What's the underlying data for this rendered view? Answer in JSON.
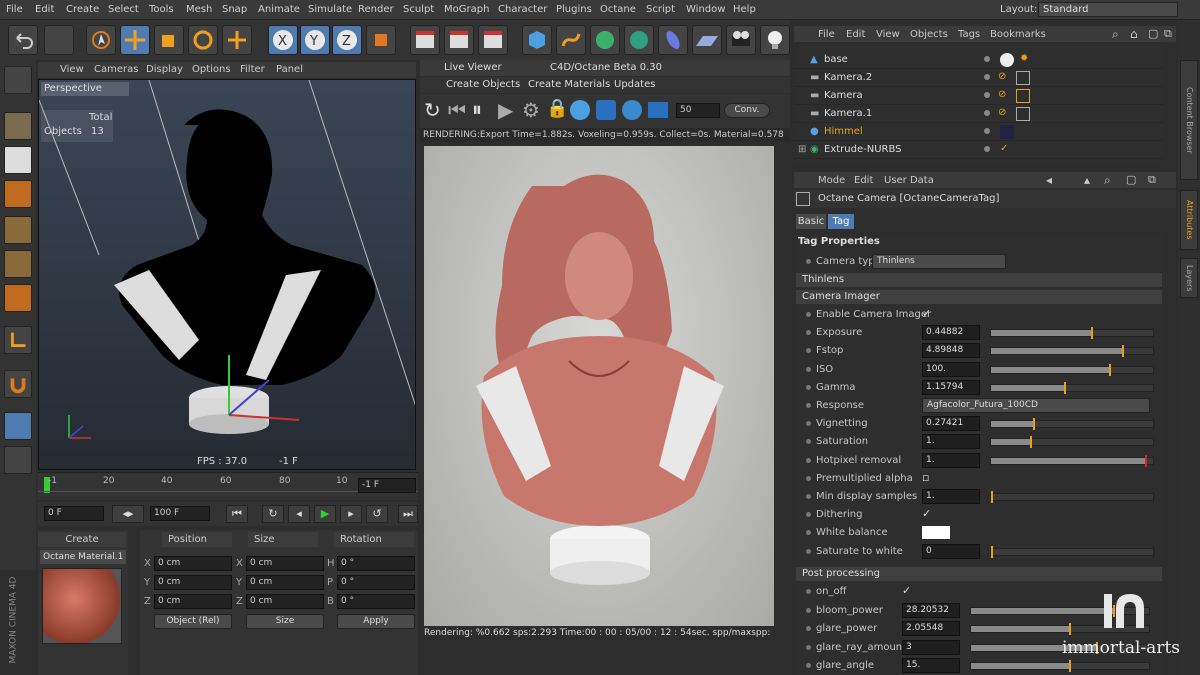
{
  "menubar": {
    "items": [
      "File",
      "Edit",
      "Create",
      "Select",
      "Tools",
      "Mesh",
      "Snap",
      "Animate",
      "Simulate",
      "Render",
      "Sculpt",
      "MoGraph",
      "Character",
      "Plugins",
      "Octane",
      "Script",
      "Window",
      "Help"
    ],
    "layout_label": "Layout:",
    "layout_value": "Standard"
  },
  "viewport": {
    "menu": [
      "View",
      "Cameras",
      "Display",
      "Options",
      "Filter",
      "Panel"
    ],
    "label": "Perspective",
    "stats_header": "Total",
    "stats_label": "Objects",
    "stats_value": "13",
    "fps": "FPS : 37.0",
    "frame": "-1 F"
  },
  "timeline": {
    "ticks": [
      "-1",
      "20",
      "40",
      "60",
      "80",
      "10"
    ],
    "end_field": "-1 F",
    "start_frame": "0 F",
    "end_frame": "100 F"
  },
  "material": {
    "create": "Create",
    "name": "Octane Material.1"
  },
  "coords": {
    "headers": [
      "Position",
      "Size",
      "Rotation"
    ],
    "rows": [
      {
        "axis": "X",
        "pos": "0 cm",
        "size": "0 cm",
        "rot_axis": "H",
        "rot": "0 °"
      },
      {
        "axis": "Y",
        "pos": "0 cm",
        "size": "0 cm",
        "rot_axis": "P",
        "rot": "0 °"
      },
      {
        "axis": "Z",
        "pos": "0 cm",
        "size": "0 cm",
        "rot_axis": "B",
        "rot": "0 °"
      }
    ],
    "mode": "Object (Rel)",
    "size_mode": "Size",
    "apply": "Apply"
  },
  "live_viewer": {
    "title": "Live Viewer",
    "subtitle": "C4D/Octane Beta 0.30",
    "tabs": [
      "Create Objects",
      "Create Materials",
      "Updates"
    ],
    "value_field": "50",
    "conv": "Conv.",
    "status": "RENDERING:Export Time=1.882s. Voxeling=0.959s. Collect=0s. Material=0.578",
    "bottom": "Rendering: %0.662 sps:2.293 Time:00 : 00 : 05/00 : 12 : 54sec. spp/maxspp:"
  },
  "object_manager": {
    "menu": [
      "File",
      "Edit",
      "View",
      "Objects",
      "Tags",
      "Bookmarks"
    ],
    "objects": [
      "base",
      "Kamera.2",
      "Kamera",
      "Kamera.1",
      "Himmel",
      "Extrude-NURBS"
    ]
  },
  "attributes": {
    "menu": [
      "Mode",
      "Edit",
      "User Data"
    ],
    "title": "Octane Camera [OctaneCameraTag]",
    "tabs": [
      "Basic",
      "Tag"
    ],
    "section_main": "Tag Properties",
    "camera_type_label": "Camera type",
    "camera_type_value": "Thinlens",
    "sections": [
      "Thinlens",
      "Camera Imager",
      "Post processing"
    ],
    "imager": [
      {
        "label": "Enable Camera Imager",
        "type": "check",
        "checked": true
      },
      {
        "label": "Exposure",
        "value": "0.44882",
        "fill": 0.62
      },
      {
        "label": "Fstop",
        "value": "4.89848",
        "fill": 0.81
      },
      {
        "label": "ISO",
        "value": "100.",
        "fill": 0.73
      },
      {
        "label": "Gamma",
        "value": "1.15794",
        "fill": 0.45
      },
      {
        "label": "Response",
        "type": "select",
        "value": "Agfacolor_Futura_100CD"
      },
      {
        "label": "Vignetting",
        "value": "0.27421",
        "fill": 0.26
      },
      {
        "label": "Saturation",
        "value": "1.",
        "fill": 0.24
      },
      {
        "label": "Hotpixel removal",
        "value": "1.",
        "fill": 0.95
      },
      {
        "label": "Premultiplied alpha",
        "type": "check",
        "checked": false
      },
      {
        "label": "Min display samples",
        "value": "1.",
        "fill": 0.0
      },
      {
        "label": "Dithering",
        "type": "check",
        "checked": true
      },
      {
        "label": "White balance",
        "type": "color",
        "color": "#ffffff"
      },
      {
        "label": "Saturate to white",
        "value": "0",
        "fill": 0.0
      }
    ],
    "post": [
      {
        "label": "on_off",
        "type": "check",
        "checked": true
      },
      {
        "label": "bloom_power",
        "value": "28.20532",
        "fill": 0.8
      },
      {
        "label": "glare_power",
        "value": "2.05548",
        "fill": 0.55
      },
      {
        "label": "glare_ray_amount",
        "value": "3",
        "fill": 0.7
      },
      {
        "label": "glare_angle",
        "value": "15.",
        "fill": 0.55
      }
    ]
  },
  "watermark": {
    "brand": "immortal-arts",
    "vertical_brand": "MAXON CINEMA 4D"
  },
  "rail": [
    "Content Browser",
    "Attributes",
    "Layers"
  ]
}
